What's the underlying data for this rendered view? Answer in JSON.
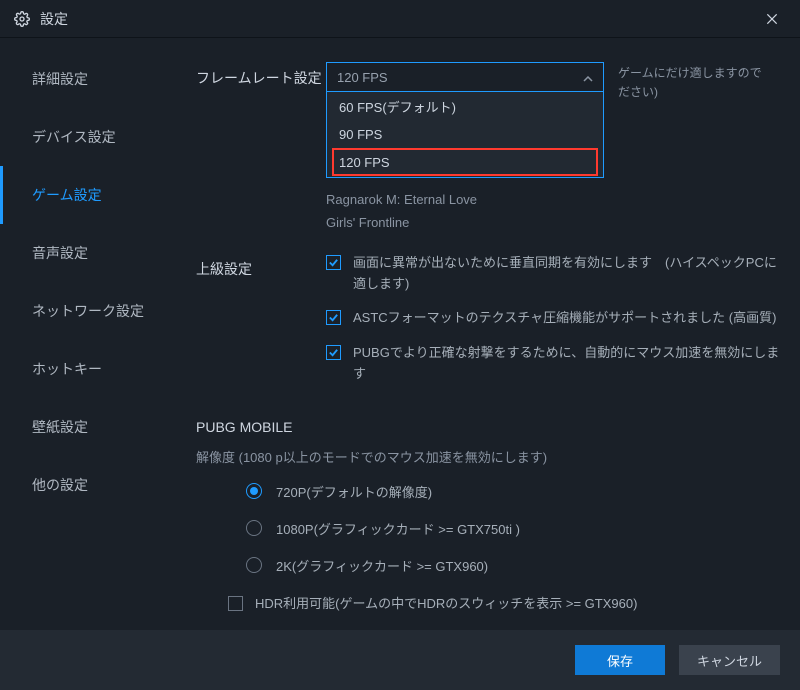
{
  "window": {
    "title": "設定"
  },
  "sidebar": {
    "items": [
      {
        "label": "詳細設定"
      },
      {
        "label": "デバイス設定"
      },
      {
        "label": "ゲーム設定"
      },
      {
        "label": "音声設定"
      },
      {
        "label": "ネットワーク設定"
      },
      {
        "label": "ホットキー"
      },
      {
        "label": "壁紙設定"
      },
      {
        "label": "他の設定"
      }
    ],
    "activeIndex": 2
  },
  "framerate": {
    "label": "フレームレート設定",
    "selected": "120 FPS",
    "options": [
      "60  FPS(デフォルト)",
      "90 FPS",
      "120 FPS"
    ],
    "side_note_line1": "ゲームにだけ適しますので",
    "side_note_line2": "ださい)",
    "game1": "Ragnarok M: Eternal Love",
    "game2": "Girls' Frontline"
  },
  "advanced": {
    "label": "上級設定",
    "items": [
      {
        "checked": true,
        "text": "画面に異常が出ないために垂直同期を有効にします　(ハイスペックPCに適します)"
      },
      {
        "checked": true,
        "text": "ASTCフォーマットのテクスチャ圧縮機能がサポートされました  (高画質)"
      },
      {
        "checked": true,
        "text": "PUBGでより正確な射撃をするために、自動的にマウス加速を無効にします"
      }
    ]
  },
  "pubg": {
    "heading": "PUBG MOBILE",
    "resolution_desc": "解像度 (1080 p以上のモードでのマウス加速を無効にします)",
    "options": [
      {
        "checked": true,
        "label": "720P(デフォルトの解像度)"
      },
      {
        "checked": false,
        "label": "1080P(グラフィックカード >= GTX750ti )"
      },
      {
        "checked": false,
        "label": "2K(グラフィックカード >= GTX960)"
      }
    ],
    "hdr": {
      "checked": false,
      "label": "HDR利用可能(ゲームの中でHDRのスウィッチを表示  >= GTX960)"
    }
  },
  "footer": {
    "save": "保存",
    "cancel": "キャンセル"
  }
}
